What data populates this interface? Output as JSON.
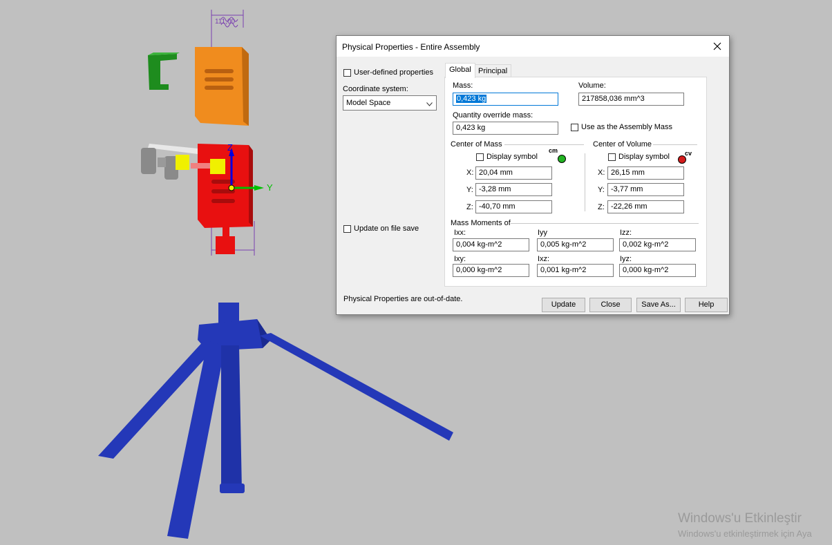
{
  "dialog": {
    "title": "Physical Properties - Entire Assembly",
    "user_defined_label": "User-defined properties",
    "coordinate_system_label": "Coordinate system:",
    "coordinate_system_value": "Model Space",
    "update_on_save_label": "Update on file save",
    "status_text": "Physical Properties are out-of-date.",
    "tabs": [
      {
        "label": "Global"
      },
      {
        "label": "Principal"
      }
    ],
    "global": {
      "mass_label": "Mass:",
      "mass_value": "0,423 kg",
      "volume_label": "Volume:",
      "volume_value": "217858,036 mm^3",
      "qty_override_label": "Quantity override mass:",
      "qty_override_value": "0,423 kg",
      "use_assembly_mass_label": "Use as the Assembly Mass",
      "center_of_mass": {
        "title": "Center of Mass",
        "display_symbol_label": "Display symbol",
        "symbol_text": "cm",
        "symbol_color": "#22b422",
        "x_label": "X:",
        "x": "20,04 mm",
        "y_label": "Y:",
        "y": "-3,28 mm",
        "z_label": "Z:",
        "z": "-40,70 mm"
      },
      "center_of_volume": {
        "title": "Center of Volume",
        "display_symbol_label": "Display symbol",
        "symbol_text": "cv",
        "symbol_color": "#d41c1c",
        "x_label": "X:",
        "x": "26,15 mm",
        "y_label": "Y:",
        "y": "-3,77 mm",
        "z_label": "Z:",
        "z": "-22,26 mm"
      },
      "mass_moments": {
        "title": "Mass Moments of",
        "ixx_label": "Ixx:",
        "ixx": "0,004 kg-m^2",
        "iyy_label": "Iyy",
        "iyy": "0,005 kg-m^2",
        "izz_label": "Izz:",
        "izz": "0,002 kg-m^2",
        "ixy_label": "Ixy:",
        "ixy": "0,000 kg-m^2",
        "ixz_label": "Ixz:",
        "ixz": "0,001 kg-m^2",
        "iyz_label": "Iyz:",
        "iyz": "0,000 kg-m^2"
      }
    },
    "buttons": {
      "update": "Update",
      "close": "Close",
      "save_as": "Save As...",
      "help": "Help"
    }
  },
  "viewport": {
    "dimension_label": "111,00",
    "axis_z": "Z",
    "axis_y": "Y",
    "background": "#c0c0c0",
    "colors": {
      "orange": "#f08c1e",
      "green": "#1e8c1e",
      "red": "#e81010",
      "blue": "#2438b8",
      "yellow": "#f0f000"
    }
  },
  "watermark": {
    "line1": "Windows'u Etkinleştir",
    "line2": "Windows'u etkinleştirmek için Aya"
  }
}
